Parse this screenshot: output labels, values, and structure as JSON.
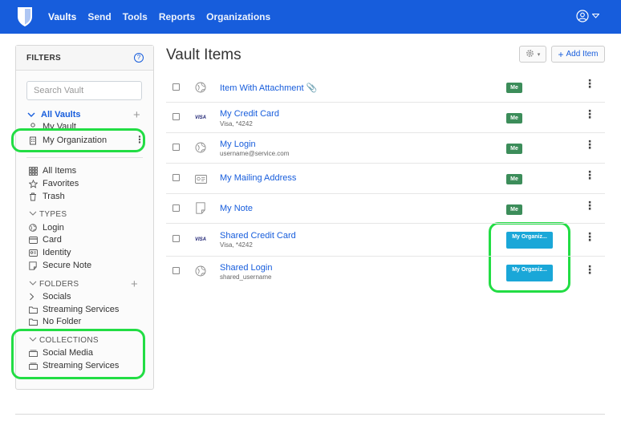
{
  "nav": {
    "links": [
      "Vaults",
      "Send",
      "Tools",
      "Reports",
      "Organizations"
    ],
    "active": "Vaults",
    "icons": {
      "logo": "shield-logo-icon",
      "account": "user-circle-icon"
    }
  },
  "sidebar": {
    "title": "FILTERS",
    "help_icon": "?",
    "search_placeholder": "Search Vault",
    "all_vaults": "All Vaults",
    "vaults": [
      "My Vault",
      "My Organization"
    ],
    "all_items": "All Items",
    "favorites": "Favorites",
    "trash": "Trash",
    "types_label": "TYPES",
    "types": [
      "Login",
      "Card",
      "Identity",
      "Secure Note"
    ],
    "folders_label": "FOLDERS",
    "folders": [
      "Socials",
      "Streaming Services",
      "No Folder"
    ],
    "collections_label": "COLLECTIONS",
    "collections": [
      "Social Media",
      "Streaming Services"
    ]
  },
  "main": {
    "title": "Vault Items",
    "add_item_label": "Add Item",
    "items": [
      {
        "name": "Item With Attachment",
        "sub": "",
        "owner": "Me",
        "icon": "globe-icon",
        "attachment": true
      },
      {
        "name": "My Credit Card",
        "sub": "Visa, *4242",
        "owner": "Me",
        "icon": "visa-card-icon"
      },
      {
        "name": "My Login",
        "sub": "username@service.com",
        "owner": "Me",
        "icon": "globe-icon"
      },
      {
        "name": "My Mailing Address",
        "sub": "",
        "owner": "Me",
        "icon": "id-card-icon"
      },
      {
        "name": "My Note",
        "sub": "",
        "owner": "Me",
        "icon": "note-icon"
      },
      {
        "name": "Shared Credit Card",
        "sub": "Visa, *4242",
        "owner": "My Organiz...",
        "icon": "visa-card-icon"
      },
      {
        "name": "Shared Login",
        "sub": "shared_username",
        "owner": "My Organiz...",
        "icon": "globe-icon"
      }
    ]
  },
  "colors": {
    "brand": "#175ddc",
    "me_badge": "#3c8d5a",
    "org_badge": "#1aa7d8",
    "highlight": "#22dd44"
  }
}
